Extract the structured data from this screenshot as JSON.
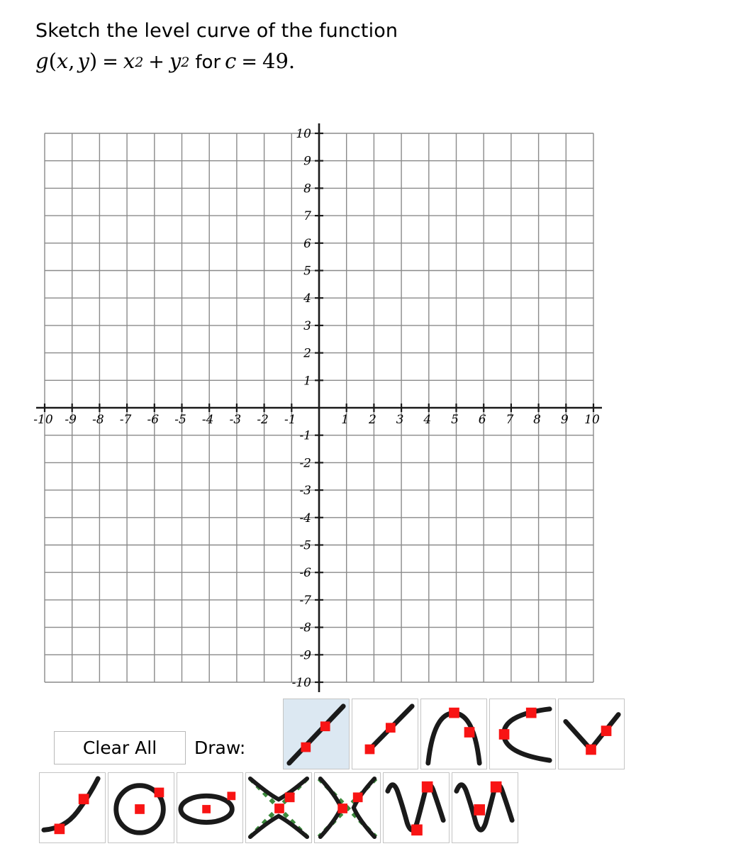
{
  "problem": {
    "line1": "Sketch the level curve of the function",
    "function_name": "g",
    "args_open": "(",
    "var_x": "x",
    "comma": ",",
    "var_y": "y",
    "args_close": ")",
    "equals": "=",
    "term1_base": "x",
    "term1_exp": "2",
    "plus": "+",
    "term2_base": "y",
    "term2_exp": "2",
    "for_word": "for",
    "var_c": "c",
    "equals2": "=",
    "c_value": "49."
  },
  "graph": {
    "x_axis_labels": [
      "-10",
      "-9",
      "-8",
      "-7",
      "-6",
      "-5",
      "-4",
      "-3",
      "-2",
      "-1",
      "1",
      "2",
      "3",
      "4",
      "5",
      "6",
      "7",
      "8",
      "9",
      "10"
    ],
    "y_axis_labels": [
      "10",
      "9",
      "8",
      "7",
      "6",
      "5",
      "4",
      "3",
      "2",
      "1",
      "-1",
      "-2",
      "-3",
      "-4",
      "-5",
      "-6",
      "-7",
      "-8",
      "-9",
      "-10"
    ],
    "xlim": [
      -10,
      10
    ],
    "ylim": [
      -10,
      10
    ],
    "grid_step": 1,
    "grid_color": "#8a8a8a",
    "axis_color": "#1a1a1a",
    "plotted_curves": []
  },
  "chart_data": {
    "type": "scatter",
    "title": "Coordinate grid for sketching level curve",
    "xlabel": "",
    "ylabel": "",
    "xlim": [
      -10,
      10
    ],
    "ylim": [
      -10,
      10
    ],
    "xticks": [
      -10,
      -9,
      -8,
      -7,
      -6,
      -5,
      -4,
      -3,
      -2,
      -1,
      1,
      2,
      3,
      4,
      5,
      6,
      7,
      8,
      9,
      10
    ],
    "yticks": [
      10,
      9,
      8,
      7,
      6,
      5,
      4,
      3,
      2,
      1,
      -1,
      -2,
      -3,
      -4,
      -5,
      -6,
      -7,
      -8,
      -9,
      -10
    ],
    "grid": true,
    "legend": "none",
    "series": []
  },
  "toolbar": {
    "clear_all_label": "Clear All",
    "draw_label": "Draw:",
    "selected_tool": "line",
    "tools_row1": [
      {
        "name": "line",
        "selected": true
      },
      {
        "name": "ray",
        "selected": false
      },
      {
        "name": "parabola-down",
        "selected": false
      },
      {
        "name": "parabola-left",
        "selected": false
      },
      {
        "name": "absolute-value",
        "selected": false
      }
    ],
    "tools_row2": [
      {
        "name": "exponential",
        "selected": false
      },
      {
        "name": "circle",
        "selected": false
      },
      {
        "name": "ellipse",
        "selected": false
      },
      {
        "name": "hyperbola-vertical",
        "selected": false
      },
      {
        "name": "hyperbola-horizontal",
        "selected": false
      },
      {
        "name": "sine",
        "selected": false
      },
      {
        "name": "cosine",
        "selected": false
      }
    ]
  },
  "colors": {
    "handle_red": "#f81414",
    "asymptote_green": "#3c8a3c",
    "selected_blue": "#dce8f2",
    "ink_black": "#1a1a1a"
  }
}
